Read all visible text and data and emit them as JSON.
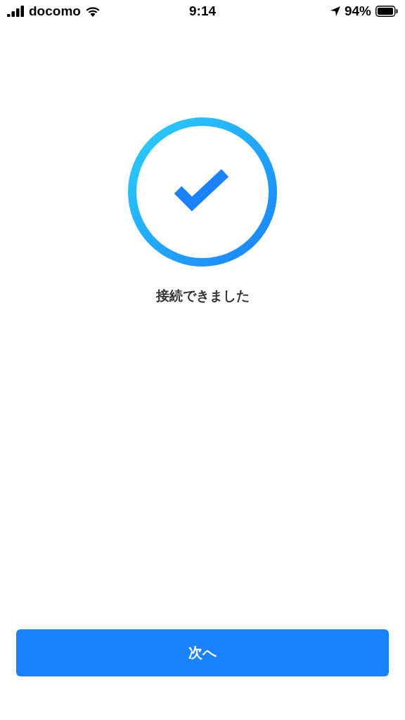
{
  "status_bar": {
    "carrier": "docomo",
    "time": "9:14",
    "battery_percent": "94%"
  },
  "result": {
    "message": "接続できました"
  },
  "next_button": {
    "label": "次へ"
  }
}
